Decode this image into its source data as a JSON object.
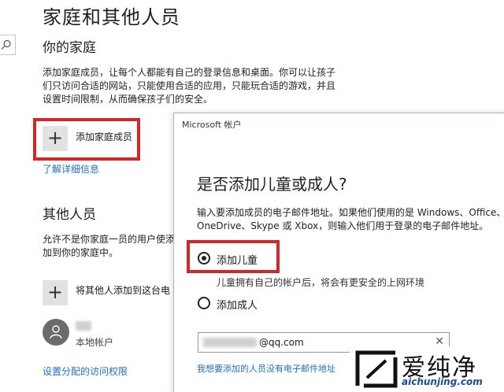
{
  "settings": {
    "page_title": "家庭和其他人员",
    "your_family": {
      "heading": "你的家庭",
      "description": "添加家庭成员，让每个人都能有自己的登录信息和桌面。你可以让孩子们只访问合适的网站，只能使用合适的应用，只能玩合适的游戏，并且设置时间限制，从而确保孩子们的安全。",
      "add_label": "添加家庭成员",
      "learn_more": "了解详细信息"
    },
    "other_people": {
      "heading": "其他人员",
      "description": "允许不是你家庭一员的用户使添加到你的家庭中。",
      "add_label": "将其他人添加到这台电",
      "local_account": "本地帐户",
      "assigned_access": "设置分配的访问权限"
    }
  },
  "dialog": {
    "title": "Microsoft 帐户",
    "heading": "是否添加儿童或成人?",
    "description": "输入要添加成员的电子邮件地址。如果他们使用的是 Windows、Office、OneDrive、Skype 或 Xbox，则输入他们用于登录的电子邮件地址。",
    "options": {
      "child": "添加儿童",
      "child_hint": "儿童拥有自己的帐户后，将会有更安全的上网环境",
      "adult": "添加成人",
      "selected": "child"
    },
    "email_value": "@qq.com",
    "clear_symbol": "✕",
    "no_email_link": "我想要添加的人员没有电子邮件地址"
  },
  "watermark": {
    "text": "爱纯净",
    "url": "aichunjing.com"
  },
  "colors": {
    "accent_link": "#1e6fc1",
    "highlight_red": "#d32626",
    "tile_gray": "#e2e2e2"
  }
}
